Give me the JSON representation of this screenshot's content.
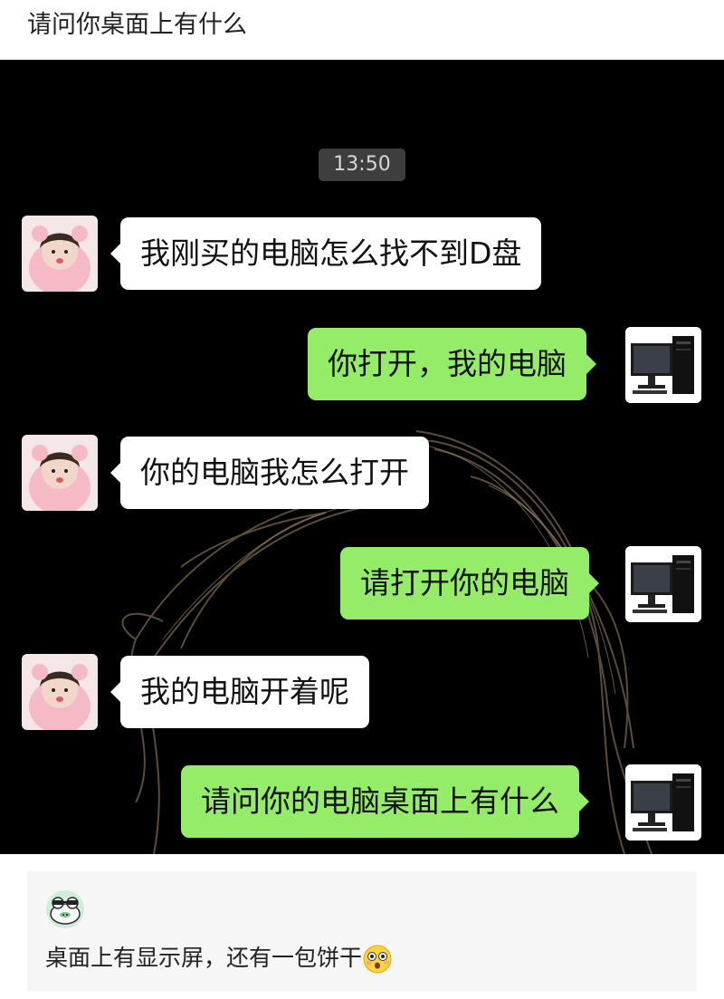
{
  "post": {
    "title": "请问你桌面上有什么"
  },
  "chat": {
    "timestamp": "13:50",
    "messages": [
      {
        "side": "left",
        "avatar": "girl-avatar",
        "text": "我刚买的电脑怎么找不到D盘"
      },
      {
        "side": "right",
        "avatar": "computer-avatar",
        "text": "你打开，我的电脑"
      },
      {
        "side": "left",
        "avatar": "girl-avatar",
        "text": "你的电脑我怎么打开"
      },
      {
        "side": "right",
        "avatar": "computer-avatar",
        "text": "请打开你的电脑"
      },
      {
        "side": "left",
        "avatar": "girl-avatar",
        "text": "我的电脑开着呢"
      },
      {
        "side": "right",
        "avatar": "computer-avatar",
        "text": "请问你的电脑桌面上有什么"
      }
    ]
  },
  "comment": {
    "avatar": "frog-avatar-icon",
    "text": "桌面上有显示屏，还有一包饼干",
    "emoji": "flushed-face-emoji"
  },
  "colors": {
    "incoming_bubble": "#ffffff",
    "outgoing_bubble": "#95ec69",
    "chat_background": "#000000",
    "timestamp_badge": "#3e3e3e"
  }
}
